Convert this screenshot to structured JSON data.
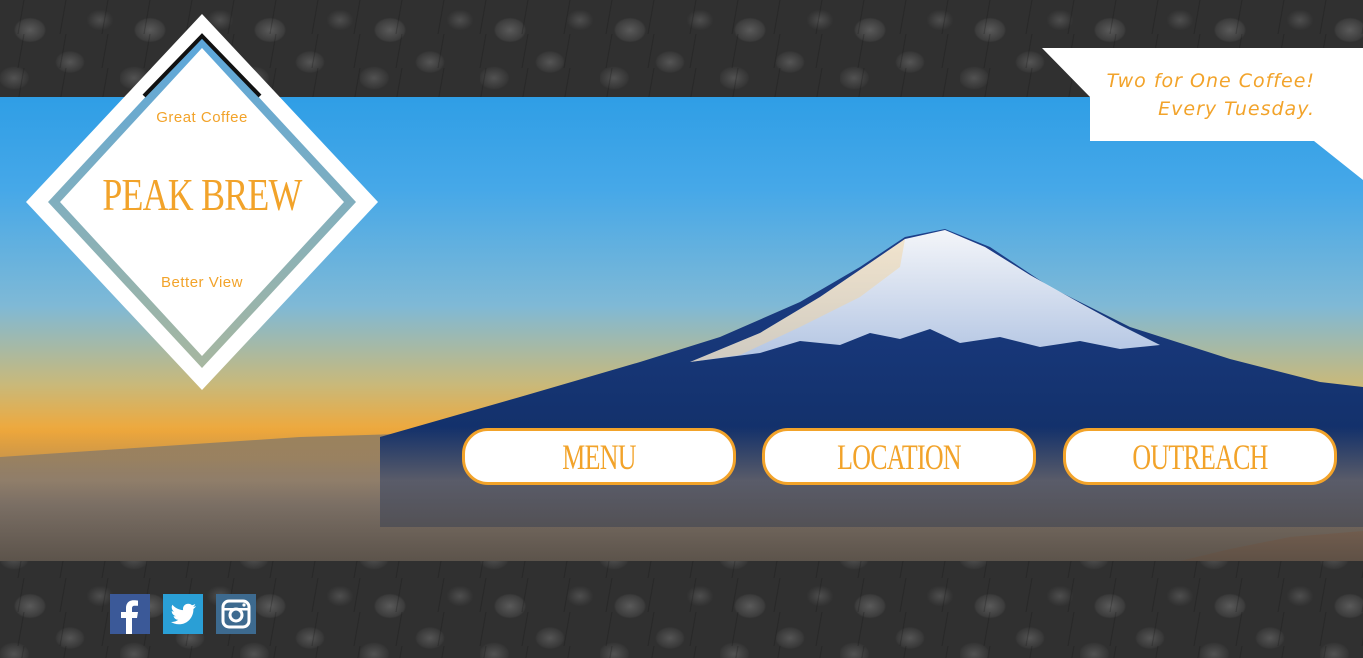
{
  "brand": {
    "tagline_top": "Great Coffee",
    "name": "PEAK BREW",
    "tagline_bottom": "Better View"
  },
  "promo": {
    "line1": "Two for One Coffee!",
    "line2": "Every Tuesday."
  },
  "nav": {
    "menu": "MENU",
    "location": "LOCATION",
    "outreach": "OUTREACH"
  },
  "social": [
    {
      "icon": "facebook-icon",
      "color": "#3b5998"
    },
    {
      "icon": "twitter-icon",
      "color": "#2a9fd6"
    },
    {
      "icon": "instagram-icon",
      "color": "#3d6a8f"
    }
  ],
  "colors": {
    "accent": "#f2a32a",
    "logo_border": "#ffffff"
  }
}
